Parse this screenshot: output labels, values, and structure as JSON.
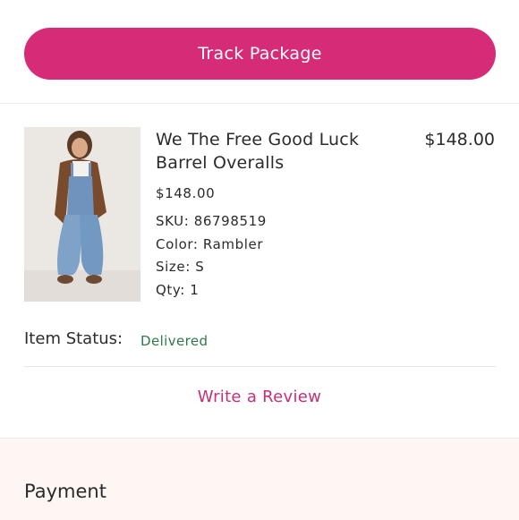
{
  "track": {
    "label": "Track Package"
  },
  "product": {
    "title": "We The Free Good Luck Barrel Overalls",
    "price": "$148.00",
    "line_price": "$148.00",
    "sku": "SKU: 86798519",
    "color": "Color: Rambler",
    "size": "Size: S",
    "qty": "Qty: 1",
    "image": "product-photo"
  },
  "status": {
    "label": "Item Status:",
    "value": "Delivered",
    "value_color": "#2f7a4a"
  },
  "review": {
    "label": "Write a Review"
  },
  "payment": {
    "title": "Payment"
  },
  "colors": {
    "accent": "#d62b76",
    "link": "#c72f75",
    "payment_bg": "#fdf6f3"
  }
}
